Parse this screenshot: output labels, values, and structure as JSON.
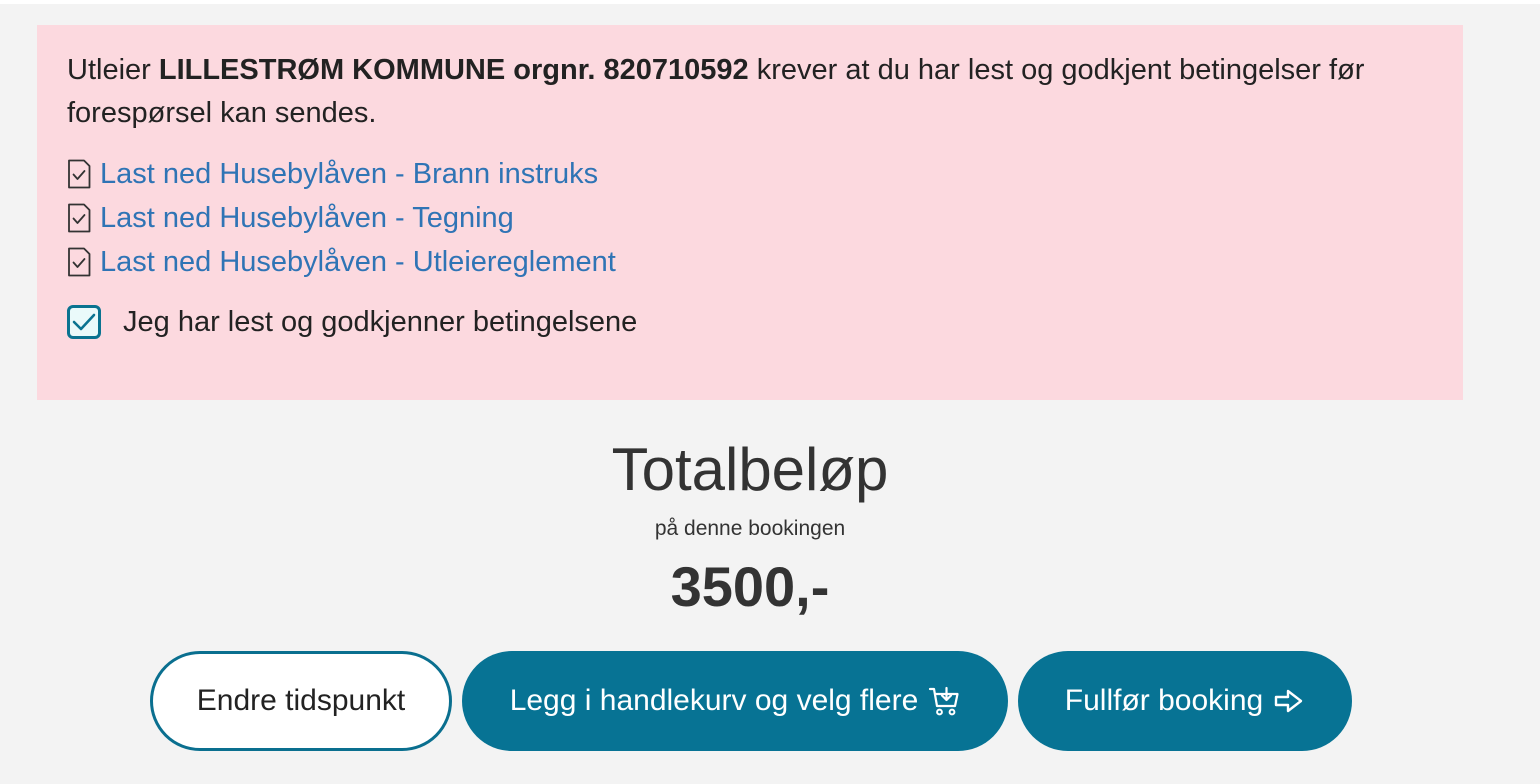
{
  "terms": {
    "intro_prefix": "Utleier ",
    "landlord": "LILLESTRØM KOMMUNE orgnr. 820710592",
    "intro_suffix": " krever at du har lest og godkjent betingelser før forespørsel kan sendes.",
    "documents": [
      {
        "label": "Last ned Husebylåven - Brann instruks",
        "icon": "document-check-icon"
      },
      {
        "label": "Last ned Husebylåven - Tegning",
        "icon": "document-check-icon"
      },
      {
        "label": "Last ned Husebylåven - Utleiereglement",
        "icon": "document-check-icon"
      }
    ],
    "consent_label": "Jeg har lest og godkjenner betingelsene",
    "consent_checked": true
  },
  "total": {
    "title": "Totalbeløp",
    "subtitle": "på denne bookingen",
    "amount": "3500,-"
  },
  "actions": {
    "change_time": "Endre tidspunkt",
    "add_to_cart": "Legg i handlekurv og velg flere",
    "add_to_cart_icon": "cart-add-icon",
    "complete": "Fullfør booking",
    "complete_icon": "arrow-right-icon"
  },
  "colors": {
    "page_background": "#f3f3f3",
    "terms_background": "#fcd9df",
    "link": "#2f74b5",
    "primary": "#077394"
  }
}
